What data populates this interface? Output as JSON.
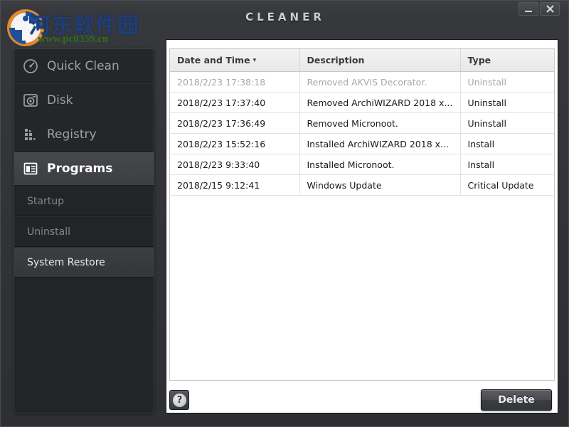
{
  "window": {
    "title": "CLEANER",
    "minimize_label": "minimize",
    "close_label": "close"
  },
  "watermark": {
    "text_cn": "河东软件园",
    "url": "www.pc0359.cn"
  },
  "sidebar": {
    "items": [
      {
        "label": "Quick Clean",
        "icon": "gauge-icon",
        "selected": false
      },
      {
        "label": "Disk",
        "icon": "hard-drive-icon",
        "selected": false
      },
      {
        "label": "Registry",
        "icon": "registry-grid-icon",
        "selected": false
      },
      {
        "label": "Programs",
        "icon": "programs-window-icon",
        "selected": true
      }
    ],
    "sub_items": [
      {
        "label": "Startup",
        "selected": false
      },
      {
        "label": "Uninstall",
        "selected": false
      },
      {
        "label": "System Restore",
        "selected": true
      }
    ]
  },
  "table": {
    "columns": [
      {
        "label": "Date and Time",
        "sorted": true,
        "sort_caret": "▾"
      },
      {
        "label": "Description",
        "sorted": false,
        "sort_caret": ""
      },
      {
        "label": "Type",
        "sorted": false,
        "sort_caret": ""
      }
    ],
    "rows": [
      {
        "date": "2018/2/23 17:38:18",
        "description": "Removed AKVIS Decorator.",
        "type": "Uninstall",
        "dimmed": true
      },
      {
        "date": "2018/2/23 17:37:40",
        "description": "Removed ArchiWIZARD 2018 x...",
        "type": "Uninstall",
        "dimmed": false
      },
      {
        "date": "2018/2/23 17:36:49",
        "description": "Removed Micronoot.",
        "type": "Uninstall",
        "dimmed": false
      },
      {
        "date": "2018/2/23 15:52:16",
        "description": "Installed ArchiWIZARD 2018 x...",
        "type": "Install",
        "dimmed": false
      },
      {
        "date": "2018/2/23 9:33:40",
        "description": "Installed Micronoot.",
        "type": "Install",
        "dimmed": false
      },
      {
        "date": "2018/2/15 9:12:41",
        "description": "Windows Update",
        "type": "Critical Update",
        "dimmed": false
      }
    ]
  },
  "footer": {
    "help_label": "?",
    "delete_label": "Delete"
  },
  "colors": {
    "window_bg": "#303236",
    "sidebar_bg": "#232427",
    "panel_bg": "#ffffff",
    "selected_nav": "#424448",
    "accent_text": "#ffffff",
    "watermark_blue": "#1f3e7a",
    "watermark_green": "#2f6e1f"
  }
}
